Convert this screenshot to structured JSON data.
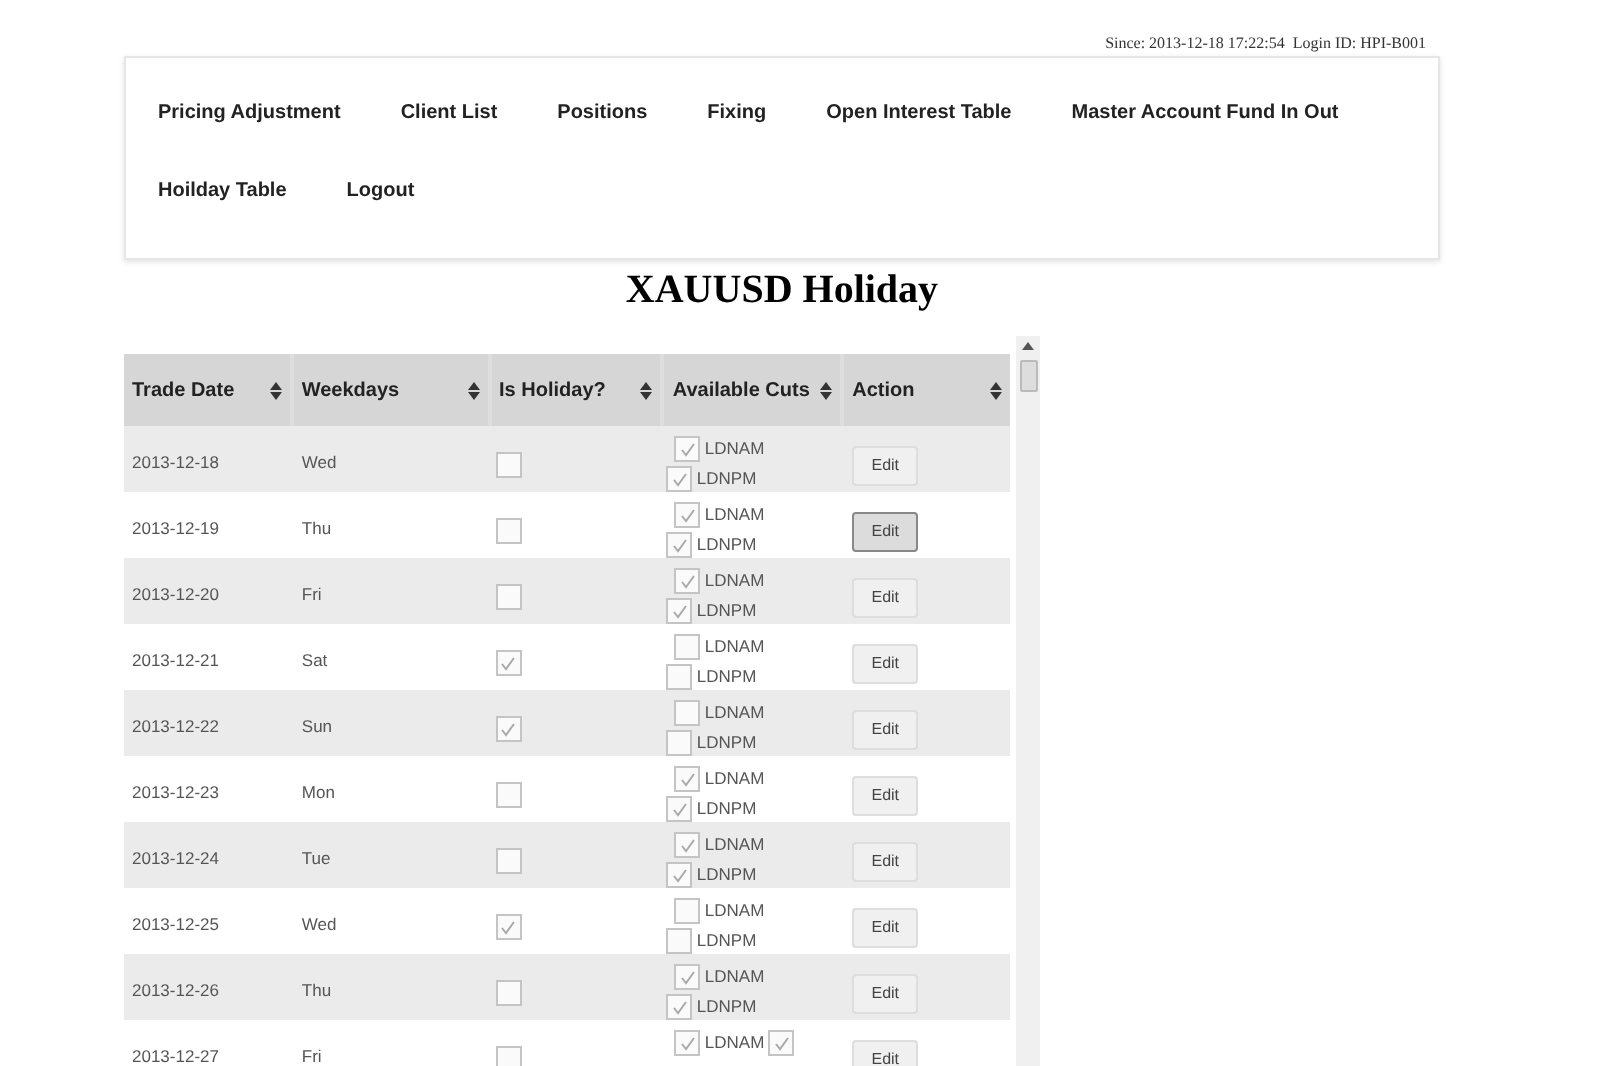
{
  "session_info": "Since: 2013-12-18 17:22:54  Login ID: HPI-B001",
  "nav": [
    "Pricing Adjustment",
    "Client List",
    "Positions",
    "Fixing",
    "Open Interest Table",
    "Master Account Fund In Out",
    "Hoilday Table",
    "Logout"
  ],
  "title": "XAUUSD Holiday",
  "table": {
    "columns": [
      "Trade Date",
      "Weekdays",
      "Is Holiday?",
      "Available Cuts",
      "Action"
    ],
    "rows": [
      {
        "date": "2013-12-18",
        "weekday": "Wed",
        "holiday": false,
        "cuts": [
          {
            "label": "LDNAM",
            "checked": true
          },
          {
            "label": "LDNPM",
            "checked": true
          }
        ],
        "action": "Edit",
        "hovered": false
      },
      {
        "date": "2013-12-19",
        "weekday": "Thu",
        "holiday": false,
        "cuts": [
          {
            "label": "LDNAM",
            "checked": true
          },
          {
            "label": "LDNPM",
            "checked": true
          }
        ],
        "action": "Edit",
        "hovered": true
      },
      {
        "date": "2013-12-20",
        "weekday": "Fri",
        "holiday": false,
        "cuts": [
          {
            "label": "LDNAM",
            "checked": true
          },
          {
            "label": "LDNPM",
            "checked": true
          }
        ],
        "action": "Edit",
        "hovered": false
      },
      {
        "date": "2013-12-21",
        "weekday": "Sat",
        "holiday": true,
        "cuts": [
          {
            "label": "LDNAM",
            "checked": false
          },
          {
            "label": "LDNPM",
            "checked": false
          }
        ],
        "action": "Edit",
        "hovered": false
      },
      {
        "date": "2013-12-22",
        "weekday": "Sun",
        "holiday": true,
        "cuts": [
          {
            "label": "LDNAM",
            "checked": false
          },
          {
            "label": "LDNPM",
            "checked": false
          }
        ],
        "action": "Edit",
        "hovered": false
      },
      {
        "date": "2013-12-23",
        "weekday": "Mon",
        "holiday": false,
        "cuts": [
          {
            "label": "LDNAM",
            "checked": true
          },
          {
            "label": "LDNPM",
            "checked": true
          }
        ],
        "action": "Edit",
        "hovered": false
      },
      {
        "date": "2013-12-24",
        "weekday": "Tue",
        "holiday": false,
        "cuts": [
          {
            "label": "LDNAM",
            "checked": true
          },
          {
            "label": "LDNPM",
            "checked": true
          }
        ],
        "action": "Edit",
        "hovered": false
      },
      {
        "date": "2013-12-25",
        "weekday": "Wed",
        "holiday": true,
        "cuts": [
          {
            "label": "LDNAM",
            "checked": false
          },
          {
            "label": "LDNPM",
            "checked": false
          }
        ],
        "action": "Edit",
        "hovered": false
      },
      {
        "date": "2013-12-26",
        "weekday": "Thu",
        "holiday": false,
        "cuts": [
          {
            "label": "LDNAM",
            "checked": true
          },
          {
            "label": "LDNPM",
            "checked": true
          }
        ],
        "action": "Edit",
        "hovered": false
      },
      {
        "date": "2013-12-27",
        "weekday": "Fri",
        "holiday": false,
        "cuts": [
          {
            "label": "LDNAM",
            "checked": true
          },
          {
            "checked": true
          }
        ],
        "action": "Edit",
        "hovered": false
      }
    ]
  }
}
